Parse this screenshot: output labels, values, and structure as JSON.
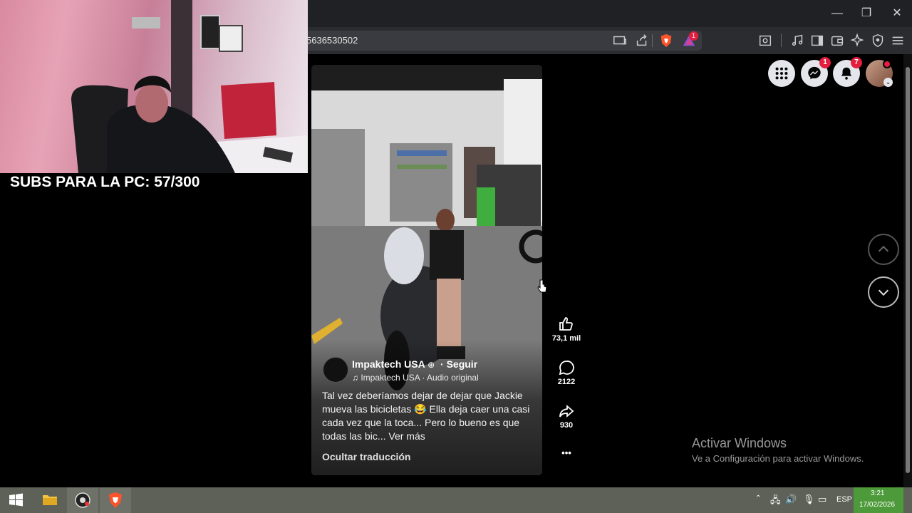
{
  "window": {
    "minimize_glyph": "—",
    "restore_glyph": "❐",
    "close_glyph": "✕"
  },
  "toolbar": {
    "url_text": "5636530502"
  },
  "stream": {
    "subs_text": "SUBS PARA LA PC: 57/300"
  },
  "fb_header": {
    "messenger_badge": "1",
    "notifications_badge": "7"
  },
  "reel": {
    "page_name": "Impaktech USA",
    "follow_label": "· Seguir",
    "audio_text": "♫ Impaktech USA · Audio original",
    "caption": "Tal vez deberíamos dejar de dejar que Jackie mueva las bicicletas 😂 Ella deja caer una casi cada vez que la toca... Pero lo bueno es que todas las bic... Ver más",
    "hide_translation": "Ocultar traducción"
  },
  "actions": {
    "likes": "73,1 mil",
    "comments": "2122",
    "shares": "930",
    "more_glyph": "•••"
  },
  "windows_notice": {
    "title": "Activar Windows",
    "subtitle": "Ve a Configuración para activar Windows."
  },
  "taskbar": {
    "lang": "ESP",
    "time": "3:21",
    "date": "17/02/2026"
  },
  "colors": {
    "badge": "#e41e3f",
    "brave": "#fb542b"
  }
}
